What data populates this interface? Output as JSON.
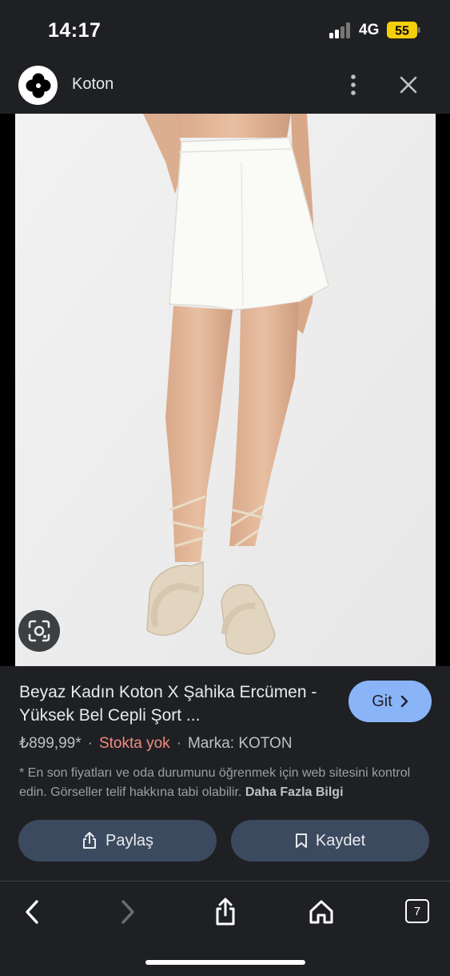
{
  "status_bar": {
    "time": "14:17",
    "network": "4G",
    "battery": "55"
  },
  "header": {
    "site_name": "Koton",
    "logo_icon": "koton-clover-icon",
    "more_icon": "more-vert-icon",
    "close_icon": "close-icon"
  },
  "image": {
    "description_icon": "lens-search-icon"
  },
  "product": {
    "title": "Beyaz Kadın Koton X Şahika Ercümen - Yüksek Bel Cepli Şort ...",
    "price": "₺899,99*",
    "stock": "Stokta yok",
    "brand": "Marka: KOTON",
    "go_label": "Git",
    "disclaimer_text": "* En son fiyatları ve oda durumunu öğrenmek için web sitesini kontrol edin. Görseller telif hakkına tabi olabilir.",
    "disclaimer_link": "Daha Fazla Bilgi"
  },
  "actions": {
    "share_label": "Paylaş",
    "save_label": "Kaydet"
  },
  "bottom_bar": {
    "tab_count": "7"
  },
  "colors": {
    "accent": "#8ab4f8",
    "out_of_stock": "#f28b82",
    "background": "#1f2023"
  }
}
